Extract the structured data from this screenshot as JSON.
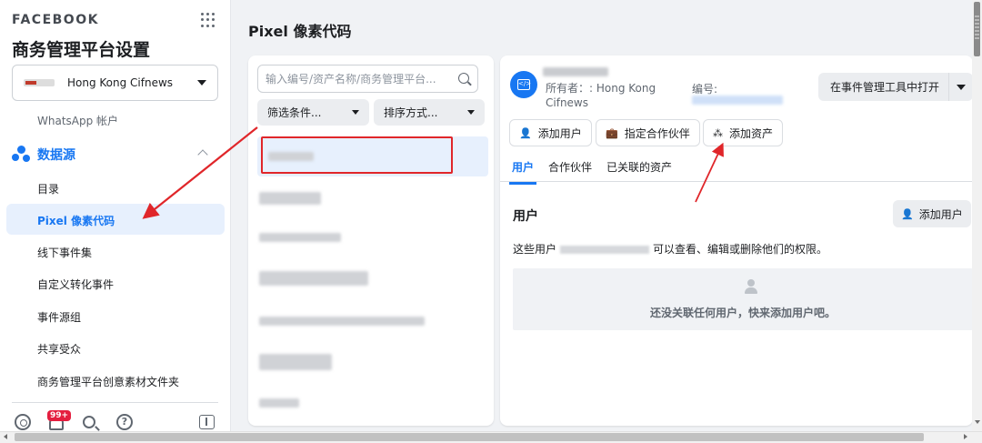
{
  "sidebar": {
    "brand": "FACEBOOK",
    "title": "商务管理平台设置",
    "account": {
      "logo_text": "cifnews",
      "name": "Hong Kong Cifnews"
    },
    "items_above": "WhatsApp 帐户",
    "section": {
      "label": "数据源"
    },
    "items": [
      {
        "label": "目录"
      },
      {
        "label": "Pixel 像素代码",
        "active": true
      },
      {
        "label": "线下事件集"
      },
      {
        "label": "自定义转化事件"
      },
      {
        "label": "事件源组"
      },
      {
        "label": "共享受众"
      },
      {
        "label": "商务管理平台创意素材文件夹"
      }
    ],
    "notification_count": "99+",
    "help_glyph": "?"
  },
  "main": {
    "title": "Pixel 像素代码",
    "list": {
      "search_placeholder": "输入编号/资产名称/商务管理平台...",
      "filter_label": "筛选条件...",
      "sort_label": "排序方式..."
    },
    "detail": {
      "owner_label": "所有者：: Hong Kong Cifnews",
      "id_label": "编号:",
      "open_button": "在事件管理工具中打开",
      "actions": {
        "add_user": "添加用户",
        "assign_partner": "指定合作伙伴",
        "add_asset": "添加资产"
      },
      "tabs": [
        {
          "label": "用户",
          "active": true
        },
        {
          "label": "合作伙伴"
        },
        {
          "label": "已关联的资产"
        }
      ],
      "users_section": {
        "title": "用户",
        "add_button": "添加用户",
        "description_prefix": "这些用户",
        "description_suffix": "可以查看、编辑或删除他们的权限。",
        "empty_text": "还没关联任何用户，快来添加用户吧。"
      }
    }
  },
  "colors": {
    "accent": "#1877f2",
    "annotation": "#e0262a",
    "selected_bg": "#e7f0fd"
  }
}
